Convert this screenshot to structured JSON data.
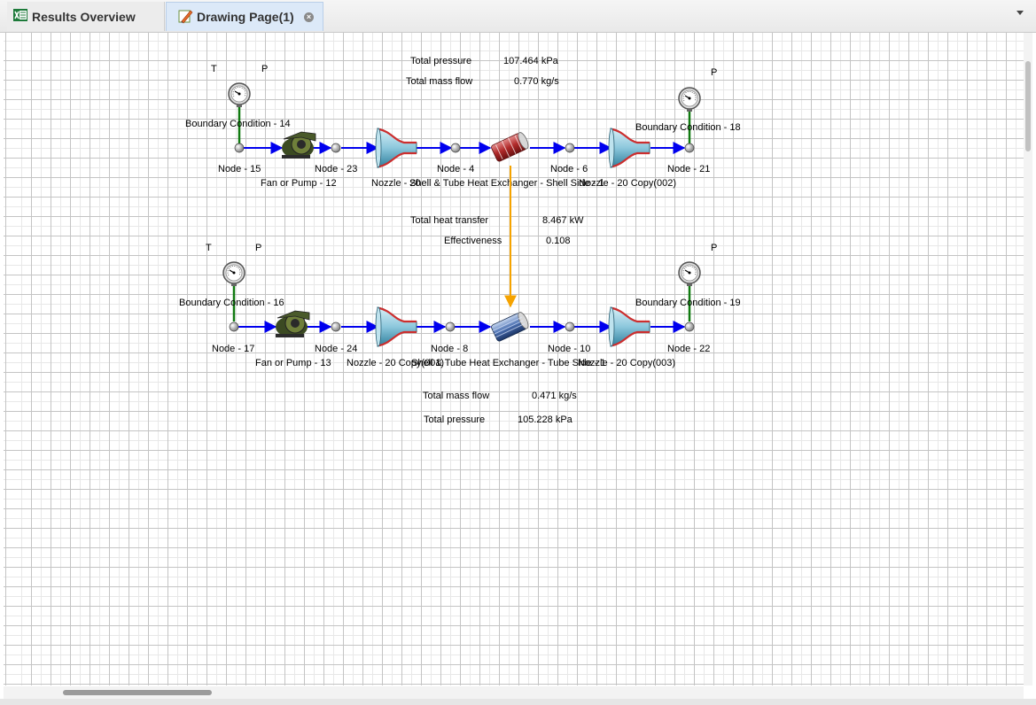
{
  "tabs": [
    {
      "label": "Results Overview",
      "icon": "excel-icon"
    },
    {
      "label": "Drawing Page(1)",
      "icon": "pencil-drawing-icon"
    }
  ],
  "diagram": {
    "top_loop": {
      "t_label": "T",
      "p_left_label": "P",
      "p_right_label": "P",
      "bc_left": "Boundary Condition - 14",
      "bc_right": "Boundary Condition - 18",
      "nodes": [
        "Node - 15",
        "Node - 23",
        "Node - 4",
        "Node - 6",
        "Node - 21"
      ],
      "fan": "Fan or Pump - 12",
      "nozzle1": "Nozzle - 20",
      "hx": "Shell & Tube Heat Exchanger - Shell Side - 1",
      "nozzle2": "Nozzle - 20 Copy(002)",
      "results": [
        {
          "label": "Total pressure",
          "value": "107.464 kPa"
        },
        {
          "label": "Total mass flow",
          "value": "0.770 kg/s"
        }
      ]
    },
    "hx_results": [
      {
        "label": "Total heat transfer",
        "value": "8.467 kW"
      },
      {
        "label": "Effectiveness",
        "value": "0.108"
      }
    ],
    "bottom_loop": {
      "t_label": "T",
      "p_left_label": "P",
      "p_right_label": "P",
      "bc_left": "Boundary Condition - 16",
      "bc_right": "Boundary Condition - 19",
      "nodes": [
        "Node - 17",
        "Node - 24",
        "Node - 8",
        "Node - 10",
        "Node - 22"
      ],
      "fan": "Fan or Pump - 13",
      "nozzle1": "Nozzle - 20 Copy(001)",
      "hx": "Shell & Tube Heat Exchanger - Tube Side - 1",
      "nozzle2": "Nozzle - 20 Copy(003)",
      "results": [
        {
          "label": "Total mass flow",
          "value": "0.471 kg/s"
        },
        {
          "label": "Total pressure",
          "value": "105.228 kPa"
        }
      ]
    }
  },
  "colors": {
    "flow_line": "#0000ee",
    "bc_line": "#117a11",
    "heat_link": "#f5a300",
    "tab_active": "#dce9f8"
  }
}
